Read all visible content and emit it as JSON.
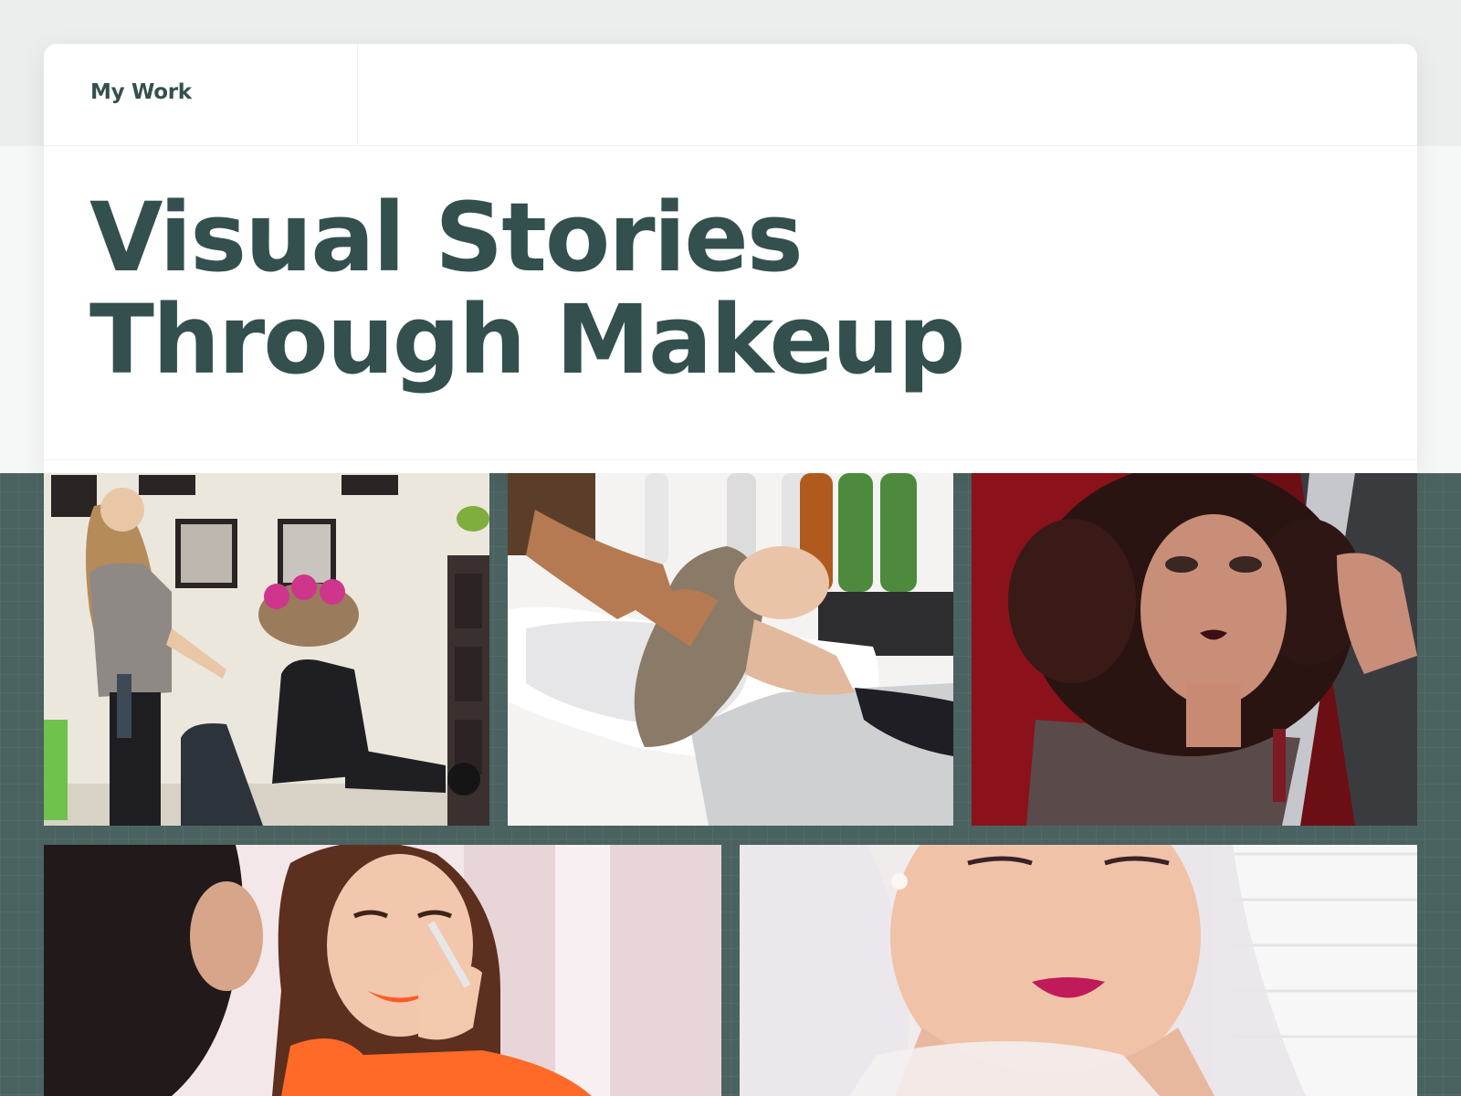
{
  "nav": {
    "label": "My Work"
  },
  "hero": {
    "title_line1": "Visual Stories",
    "title_line2": "Through Makeup"
  },
  "colors": {
    "brand": "#34504e",
    "section_bg": "#4a6260",
    "card": "#ffffff"
  },
  "gallery": [
    {
      "name": "salon-hair-curlers-photo"
    },
    {
      "name": "hair-wash-photo"
    },
    {
      "name": "red-light-portrait-photo"
    },
    {
      "name": "eyebrow-makeup-photo"
    },
    {
      "name": "bridal-makeup-photo"
    }
  ]
}
